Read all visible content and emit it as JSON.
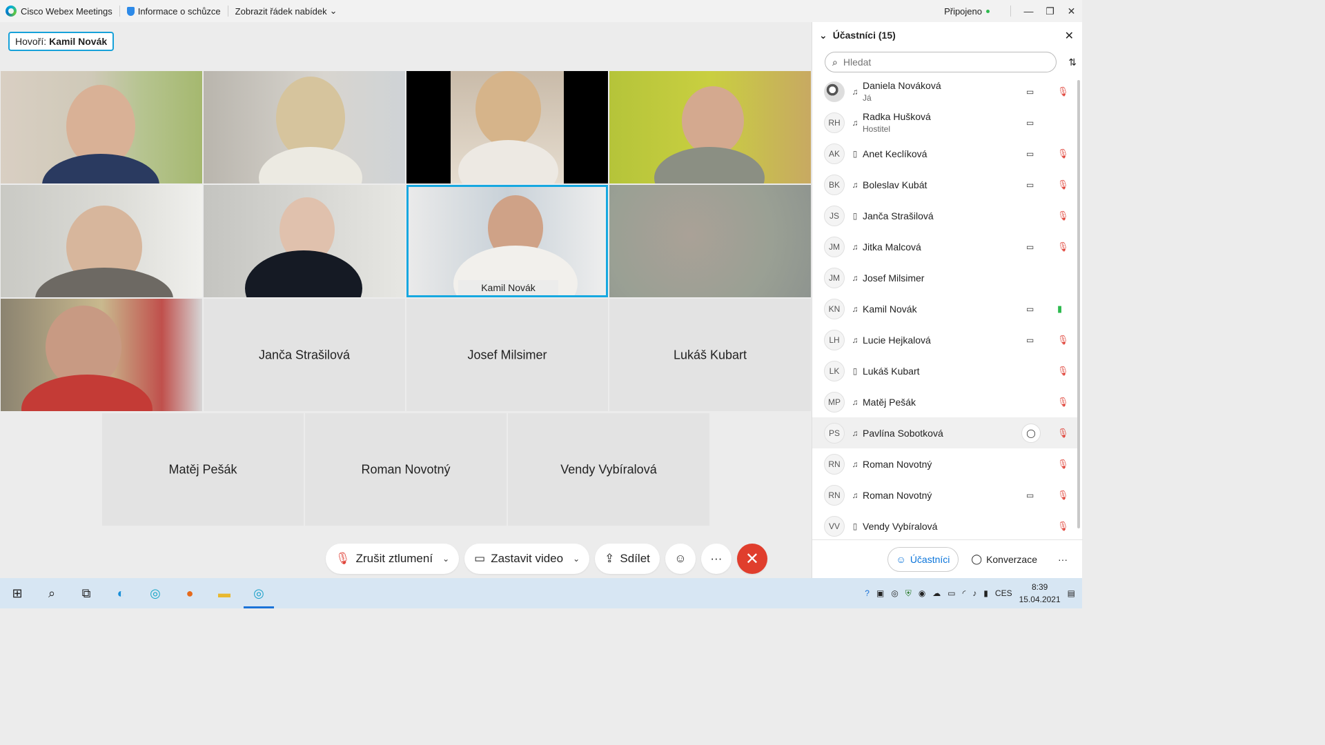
{
  "titlebar": {
    "app_title": "Cisco Webex Meetings",
    "info_label": "Informace o schůzce",
    "menu_label": "Zobrazit řádek nabídek",
    "status": "Připojeno"
  },
  "speaker": {
    "prefix": "Hovoří:",
    "name": "Kamil Novák"
  },
  "tiles": {
    "active_caption": "Kamil Novák",
    "janca": "Janča Strašilová",
    "josef": "Josef Milsimer",
    "lukas": "Lukáš Kubart",
    "matej": "Matěj Pešák",
    "roman": "Roman Novotný",
    "vendy": "Vendy Vybíralová"
  },
  "controls": {
    "unmute": "Zrušit ztlumení",
    "stop_video": "Zastavit video",
    "share": "Sdílet"
  },
  "panel": {
    "title": "Účastníci (15)",
    "search_placeholder": "Hledat",
    "participants": [
      {
        "initials": "",
        "name": "Daniela Nováková",
        "sub": "Já"
      },
      {
        "initials": "RH",
        "name": "Radka Hušková",
        "sub": "Hostitel"
      },
      {
        "initials": "AK",
        "name": "Anet Keclíková",
        "sub": ""
      },
      {
        "initials": "BK",
        "name": "Boleslav Kubát",
        "sub": ""
      },
      {
        "initials": "JS",
        "name": "Janča Strašilová",
        "sub": ""
      },
      {
        "initials": "JM",
        "name": "Jitka Malcová",
        "sub": ""
      },
      {
        "initials": "JM",
        "name": "Josef Milsimer",
        "sub": ""
      },
      {
        "initials": "KN",
        "name": "Kamil Novák",
        "sub": ""
      },
      {
        "initials": "LH",
        "name": "Lucie Hejkalová",
        "sub": ""
      },
      {
        "initials": "LK",
        "name": "Lukáš Kubart",
        "sub": ""
      },
      {
        "initials": "MP",
        "name": "Matěj Pešák",
        "sub": ""
      },
      {
        "initials": "PS",
        "name": "Pavlína Sobotková",
        "sub": ""
      },
      {
        "initials": "RN",
        "name": "Roman Novotný",
        "sub": ""
      },
      {
        "initials": "RN",
        "name": "Roman Novotný",
        "sub": ""
      },
      {
        "initials": "VV",
        "name": "Vendy Vybíralová",
        "sub": ""
      }
    ],
    "foot_participants": "Účastníci",
    "foot_chat": "Konverzace"
  },
  "taskbar": {
    "lang": "CES",
    "time": "8:39",
    "date": "15.04.2021"
  },
  "colors": {
    "accent": "#16a8e0",
    "end_call": "#e03e2d",
    "muted": "#e0453b",
    "active_mic": "#2dba4e",
    "taskbar": "#d7e6f3"
  }
}
